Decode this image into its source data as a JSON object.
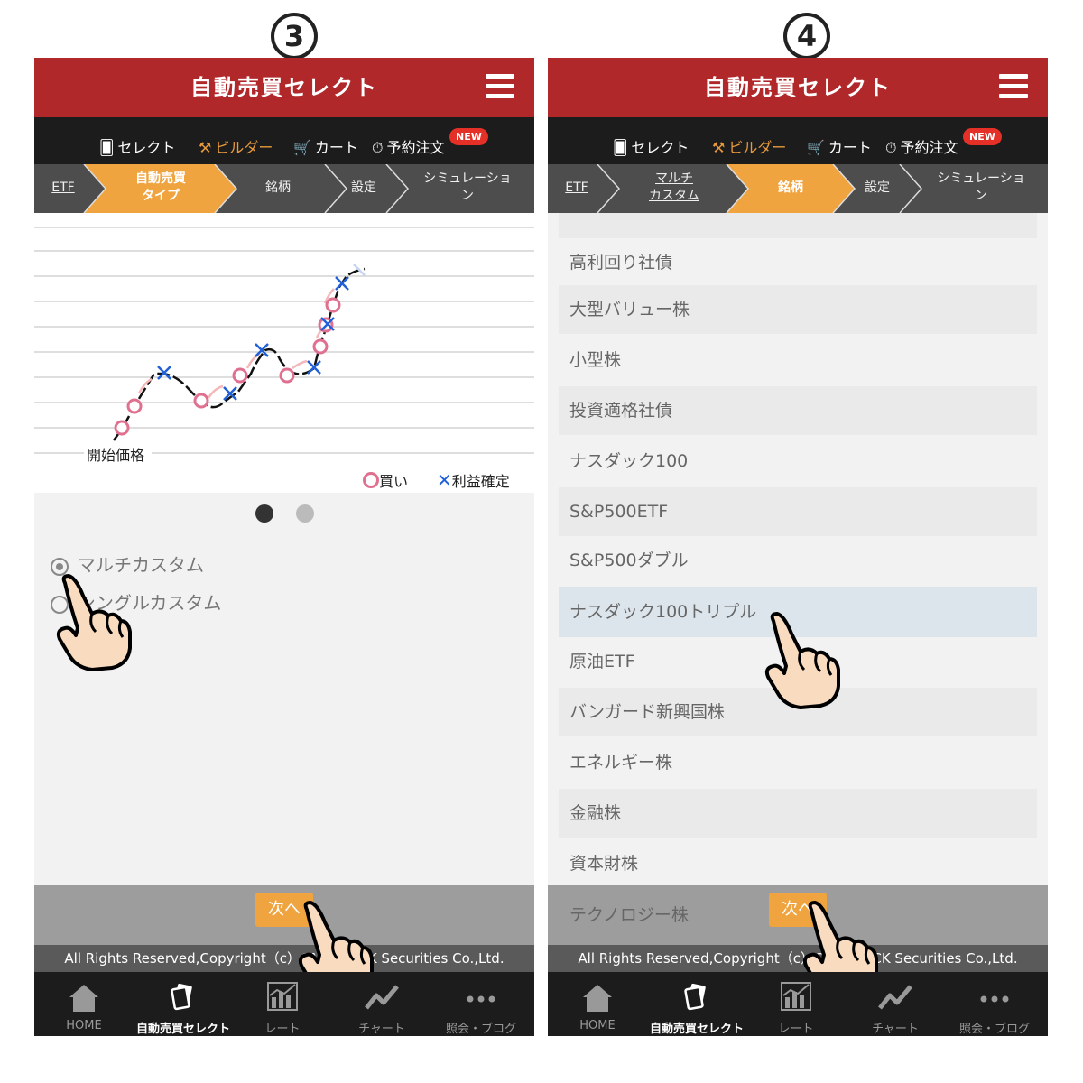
{
  "left": {
    "step_label": "3",
    "title": "自動売買セレクト",
    "nav": {
      "select": "セレクト",
      "builder": "ビルダー",
      "cart": "カート",
      "reserve": "予約注文",
      "new_badge": "NEW"
    },
    "steps": [
      {
        "label": "ETF",
        "state": "link"
      },
      {
        "label": "自動売買\nタイプ",
        "state": "active"
      },
      {
        "label": "銘柄",
        "state": "normal"
      },
      {
        "label": "設定",
        "state": "normal"
      },
      {
        "label": "シミュレーショ\nン",
        "state": "normal"
      }
    ],
    "chart": {
      "start_label": "開始価格",
      "legend_buy": "買い",
      "legend_profit": "利益確定"
    },
    "carousel": {
      "active_index": 0,
      "count": 2
    },
    "options": [
      {
        "label": "マルチカスタム",
        "checked": true
      },
      {
        "label": "シングルカスタム",
        "checked": false
      }
    ],
    "next_button": "次へ",
    "copyright": "All Rights Reserved,Copyright（c）GMO CLICK Securities Co.,Ltd."
  },
  "right": {
    "step_label": "4",
    "title": "自動売買セレクト",
    "nav": {
      "select": "セレクト",
      "builder": "ビルダー",
      "cart": "カート",
      "reserve": "予約注文",
      "new_badge": "NEW"
    },
    "steps": [
      {
        "label": "ETF",
        "state": "link"
      },
      {
        "label": "マルチ\nカスタム",
        "state": "link"
      },
      {
        "label": "銘柄",
        "state": "active"
      },
      {
        "label": "設定",
        "state": "normal"
      },
      {
        "label": "シミュレーショ\nン",
        "state": "normal"
      }
    ],
    "list_items": [
      "高利回り社債",
      "大型バリュー株",
      "小型株",
      "投資適格社債",
      "ナスダック100",
      "S&P500ETF",
      "S&P500ダブル",
      "ナスダック100トリプル",
      "原油ETF",
      "バンガード新興国株",
      "エネルギー株",
      "金融株",
      "資本財株",
      "テクノロジー株"
    ],
    "selected_item": "ナスダック100トリプル",
    "next_button": "次へ",
    "copyright": "All Rights Reserved,Copyright（c）GMO CLICK Securities Co.,Ltd."
  },
  "tabbar": [
    {
      "label": "HOME",
      "icon": "home-icon"
    },
    {
      "label": "自動売買セレクト",
      "icon": "cards-icon"
    },
    {
      "label": "レート",
      "icon": "rate-chart-icon"
    },
    {
      "label": "チャート",
      "icon": "line-chart-icon"
    },
    {
      "label": "照会・ブログ",
      "icon": "more-dots-icon"
    }
  ],
  "colors": {
    "brand_red": "#b1282b",
    "accent_orange": "#f0a440",
    "nav_black": "#1c1c1c",
    "buy_pink": "#e07090",
    "profit_blue": "#2060d8"
  }
}
